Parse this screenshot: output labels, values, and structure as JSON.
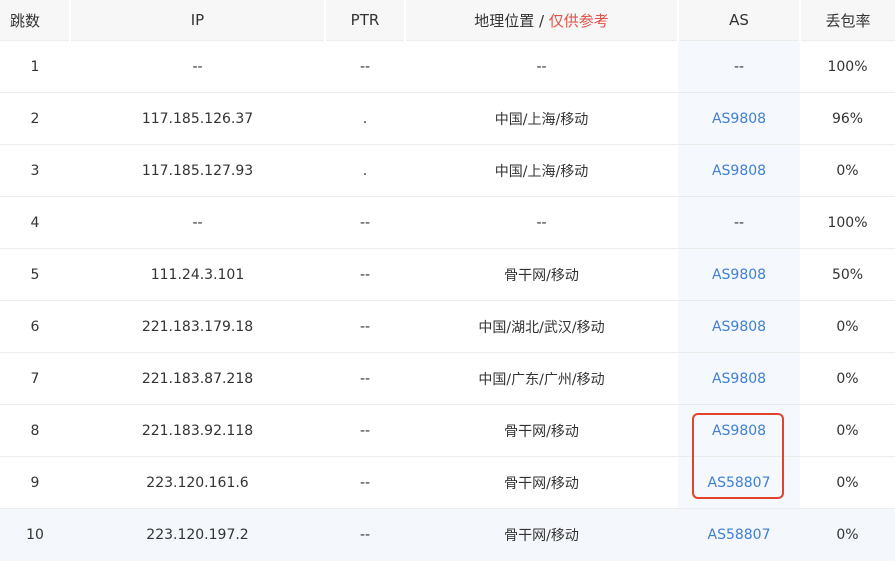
{
  "headers": {
    "hop": "跳数",
    "ip": "IP",
    "ptr": "PTR",
    "geo": "地理位置 / ",
    "geo_note": "仅供参考",
    "as": "AS",
    "loss": "丢包率"
  },
  "colors": {
    "link": "#3f7fd4",
    "highlight": "#e2514a",
    "outline": "#e0442a"
  },
  "rows": [
    {
      "hop": "1",
      "ip": "--",
      "ptr": "--",
      "geo": "--",
      "as": "--",
      "loss": "100%"
    },
    {
      "hop": "2",
      "ip": "117.185.126.37",
      "ptr": ".",
      "geo": "中国/上海/移动",
      "as": "AS9808",
      "loss": "96%"
    },
    {
      "hop": "3",
      "ip": "117.185.127.93",
      "ptr": ".",
      "geo": "中国/上海/移动",
      "as": "AS9808",
      "loss": "0%"
    },
    {
      "hop": "4",
      "ip": "--",
      "ptr": "--",
      "geo": "--",
      "as": "--",
      "loss": "100%"
    },
    {
      "hop": "5",
      "ip": "111.24.3.101",
      "ptr": "--",
      "geo": "骨干网/移动",
      "as": "AS9808",
      "loss": "50%"
    },
    {
      "hop": "6",
      "ip": "221.183.179.18",
      "ptr": "--",
      "geo": "中国/湖北/武汉/移动",
      "as": "AS9808",
      "loss": "0%"
    },
    {
      "hop": "7",
      "ip": "221.183.87.218",
      "ptr": "--",
      "geo": "中国/广东/广州/移动",
      "as": "AS9808",
      "loss": "0%"
    },
    {
      "hop": "8",
      "ip": "221.183.92.118",
      "ptr": "--",
      "geo": "骨干网/移动",
      "as": "AS9808",
      "loss": "0%"
    },
    {
      "hop": "9",
      "ip": "223.120.161.6",
      "ptr": "--",
      "geo": "骨干网/移动",
      "as": "AS58807",
      "loss": "0%"
    },
    {
      "hop": "10",
      "ip": "223.120.197.2",
      "ptr": "--",
      "geo": "骨干网/移动",
      "as": "AS58807",
      "loss": "0%"
    }
  ]
}
